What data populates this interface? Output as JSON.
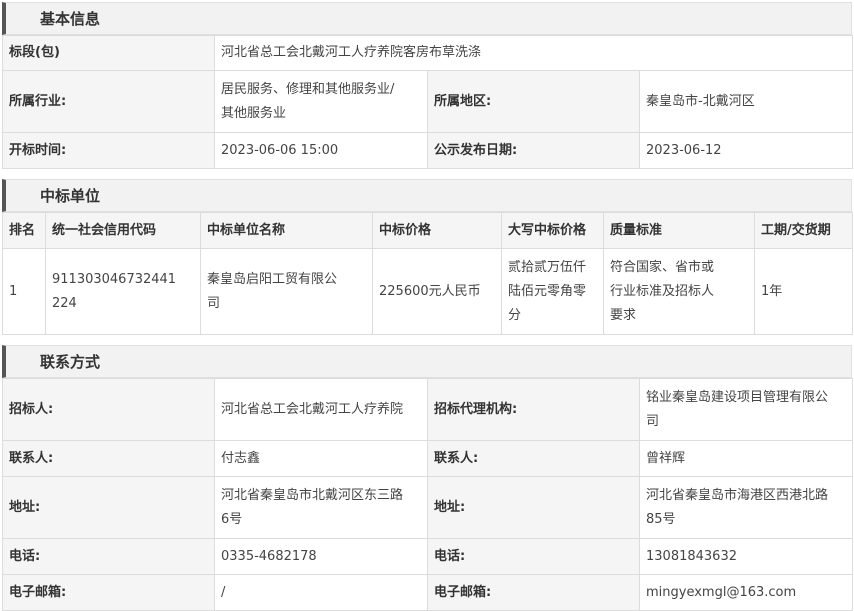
{
  "basic": {
    "title": "基本信息",
    "section_label": "标段(包)",
    "section_value": "河北省总工会北戴河工人疗养院客房布草洗涤",
    "industry_label": "所属行业:",
    "industry_value_line1": "居民服务、修理和其他服务业/",
    "industry_value_line2": "其他服务业",
    "region_label": "所属地区:",
    "region_value": "秦皇岛市-北戴河区",
    "open_label": "开标时间:",
    "open_value": "2023-06-06 15:00",
    "publish_label": "公示发布日期:",
    "publish_value": "2023-06-12"
  },
  "winner": {
    "title": "中标单位",
    "headers": [
      "排名",
      "统一社会信用代码",
      "中标单位名称",
      "中标价格",
      "大写中标价格",
      "质量标准",
      "工期/交货期"
    ],
    "row": {
      "rank": "1",
      "code_line1": "911303046732441",
      "code_line2": "224",
      "name_line1": "秦皇岛启阳工贸有限公",
      "name_line2": "司",
      "price": "225600元人民币",
      "price_cn_line1": "贰拾贰万伍仟",
      "price_cn_line2": "陆佰元零角零",
      "price_cn_line3": "分",
      "quality_line1": "符合国家、省市或",
      "quality_line2": "行业标准及招标人",
      "quality_line3": "要求",
      "period": "1年"
    }
  },
  "contact": {
    "title": "联系方式",
    "tenderer_label": "招标人:",
    "tenderer_value": "河北省总工会北戴河工人疗养院",
    "agency_label": "招标代理机构:",
    "agency_value_line1": "铭业秦皇岛建设项目管理有限公",
    "agency_value_line2": "司",
    "contact_label_left": "联系人:",
    "contact_value_left": "付志鑫",
    "contact_label_right": "联系人:",
    "contact_value_right": "曾祥辉",
    "address_label_left": "地址:",
    "address_value_left_line1": "河北省秦皇岛市北戴河区东三路",
    "address_value_left_line2": "6号",
    "address_label_right": "地址:",
    "address_value_right_line1": "河北省秦皇岛市海港区西港北路",
    "address_value_right_line2": "85号",
    "phone_label_left": "电话:",
    "phone_value_left": "0335-4682178",
    "phone_label_right": "电话:",
    "phone_value_right": "13081843632",
    "email_label_left": "电子邮箱:",
    "email_value_left": "/",
    "email_label_right": "电子邮箱:",
    "email_value_right": "mingyexmgl@163.com"
  }
}
